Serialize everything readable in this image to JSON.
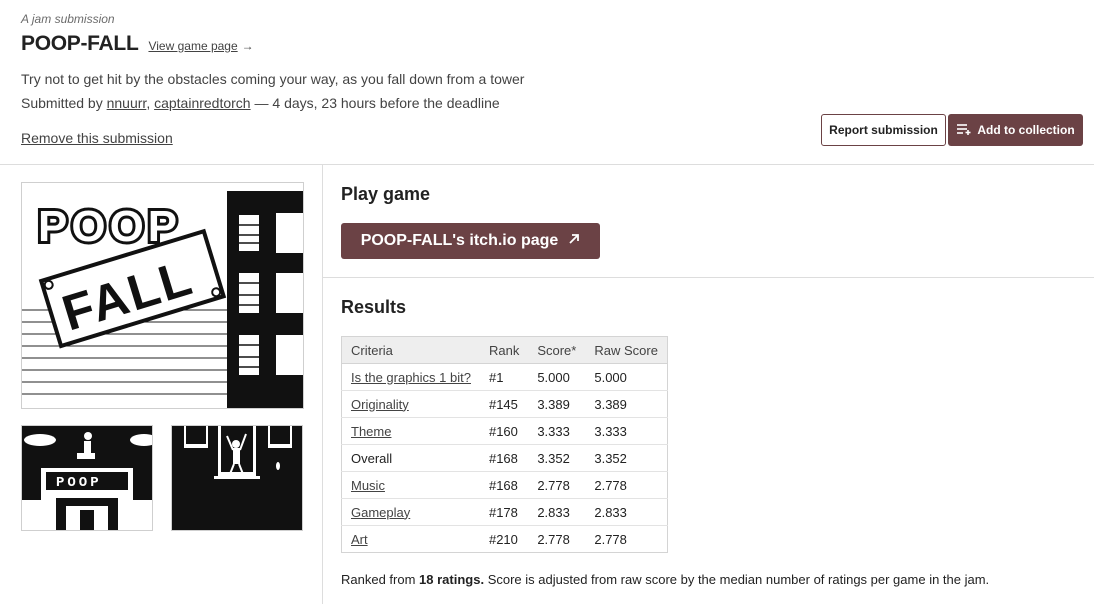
{
  "header": {
    "jam_label": "A jam submission",
    "title": "POOP-FALL",
    "view_link": "View game page",
    "view_arrow": "→",
    "description": "Try not to get hit by the obstacles coming your way, as you fall down from a tower",
    "submitted_prefix": "Submitted by",
    "authors": [
      "nnuurr",
      "captainredtorch"
    ],
    "author_separator": ",",
    "deadline_text": "— 4 days, 23 hours before the deadline",
    "remove_link": "Remove this submission",
    "report_button": "Report submission",
    "collection_button": "Add to collection"
  },
  "screenshots": {
    "main_logo_top": "POOP",
    "main_logo_bottom": "FALL",
    "thumb_sign": "POOP"
  },
  "play": {
    "heading": "Play game",
    "button": "POOP-FALL's itch.io page"
  },
  "results": {
    "heading": "Results",
    "columns": [
      "Criteria",
      "Rank",
      "Score*",
      "Raw Score"
    ],
    "rows": [
      {
        "criteria": "Is the graphics 1 bit?",
        "link": true,
        "rank": "#1",
        "score": "5.000",
        "raw": "5.000"
      },
      {
        "criteria": "Originality",
        "link": true,
        "rank": "#145",
        "score": "3.389",
        "raw": "3.389"
      },
      {
        "criteria": "Theme",
        "link": true,
        "rank": "#160",
        "score": "3.333",
        "raw": "3.333"
      },
      {
        "criteria": "Overall",
        "link": false,
        "rank": "#168",
        "score": "3.352",
        "raw": "3.352"
      },
      {
        "criteria": "Music",
        "link": true,
        "rank": "#168",
        "score": "2.778",
        "raw": "2.778"
      },
      {
        "criteria": "Gameplay",
        "link": true,
        "rank": "#178",
        "score": "2.833",
        "raw": "2.833"
      },
      {
        "criteria": "Art",
        "link": true,
        "rank": "#210",
        "score": "2.778",
        "raw": "2.778"
      }
    ],
    "note_prefix": "Ranked from",
    "note_ratings": "18 ratings.",
    "note_suffix": "Score is adjusted from raw score by the median number of ratings per game in the jam."
  },
  "colors": {
    "accent": "#6b4245",
    "text": "#434343",
    "heading": "#222222",
    "border": "#dddddd"
  },
  "icons": {
    "collection": "add-to-collection-icon",
    "external": "external-link-arrow-icon"
  }
}
